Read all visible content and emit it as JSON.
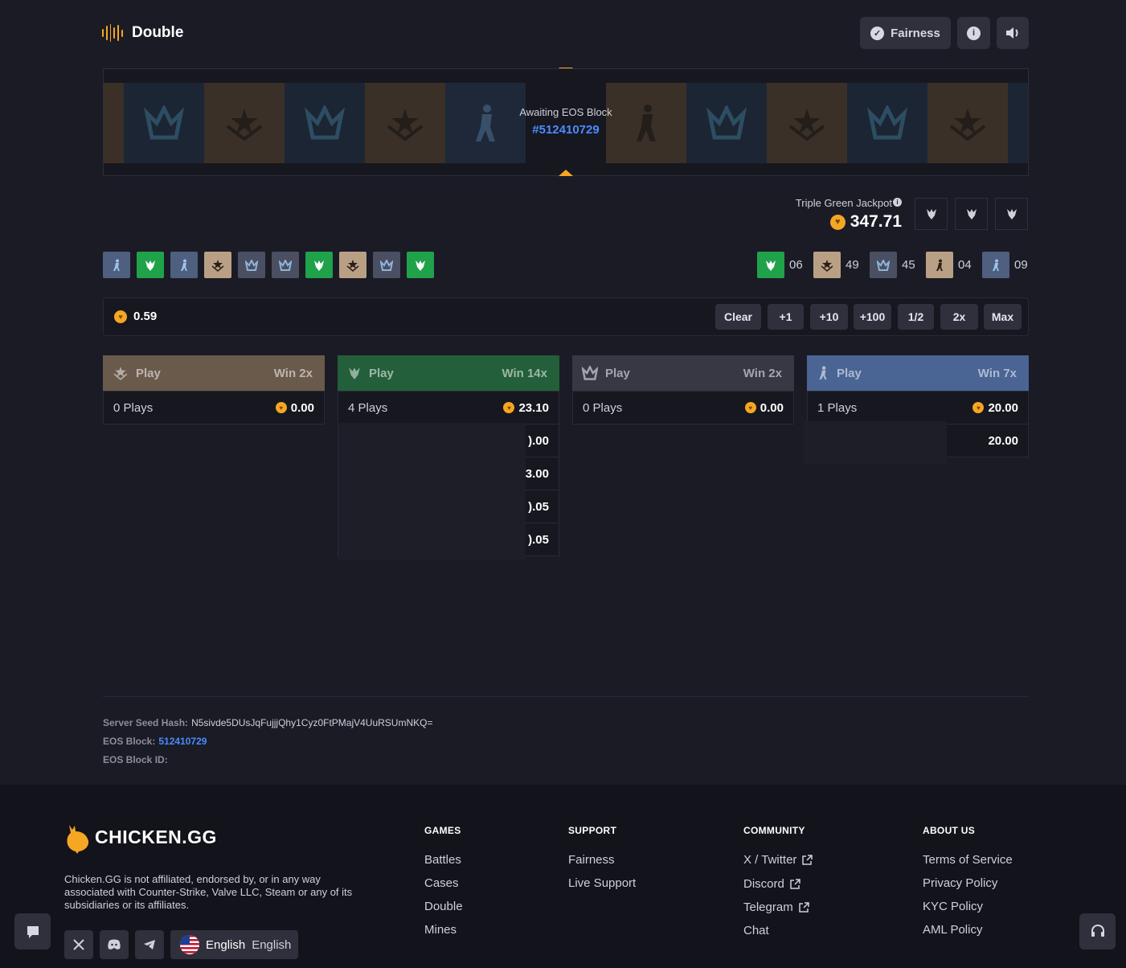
{
  "header": {
    "title": "Double",
    "fairness_label": "Fairness",
    "info_icon": "info-icon",
    "sound_icon": "speaker-icon"
  },
  "roulette": {
    "status_text": "Awaiting EOS Block",
    "block_number": "#512410729",
    "tiles": [
      "tan-badge",
      "navy-crown",
      "tan-badge",
      "navy-crown",
      "blue-soldier",
      "tan-soldier",
      "navy-crown",
      "tan-badge",
      "navy-crown",
      "tan-badge"
    ]
  },
  "jackpot": {
    "label": "Triple Green Jackpot",
    "value": "347.71",
    "slots": [
      "chicken-icon",
      "chicken-icon",
      "chicken-icon"
    ]
  },
  "history": [
    "blue-soldier",
    "green-chicken",
    "blue-soldier",
    "tan-badge",
    "gray-crown",
    "gray-crown",
    "green-chicken",
    "tan-badge",
    "gray-crown",
    "green-chicken"
  ],
  "stats": [
    {
      "type": "green-chicken",
      "count": "06"
    },
    {
      "type": "tan-badge",
      "count": "49"
    },
    {
      "type": "gray-crown",
      "count": "45"
    },
    {
      "type": "tan-soldier",
      "count": "04"
    },
    {
      "type": "blue-soldier",
      "count": "09"
    }
  ],
  "bet": {
    "amount": "0.59",
    "buttons": [
      "Clear",
      "+1",
      "+10",
      "+100",
      "1/2",
      "2x",
      "Max"
    ]
  },
  "columns": [
    {
      "play": "Play",
      "win": "Win 2x",
      "plays": "0 Plays",
      "total": "0.00",
      "color": "#6a5a4c",
      "rows": []
    },
    {
      "play": "Play",
      "win": "Win 14x",
      "plays": "4 Plays",
      "total": "23.10",
      "color": "#235f3a",
      "rows": [
        ").00",
        "3.00",
        ").05",
        ").05"
      ]
    },
    {
      "play": "Play",
      "win": "Win 2x",
      "plays": "0 Plays",
      "total": "0.00",
      "color": "#373844",
      "rows": []
    },
    {
      "play": "Play",
      "win": "Win 7x",
      "plays": "1 Plays",
      "total": "20.00",
      "color": "#4a6494",
      "rows": [
        "20.00"
      ]
    }
  ],
  "seed": {
    "hash_label": "Server Seed Hash:",
    "hash_value": "N5sivde5DUsJqFujjjQhy1Cyz0FtPMajV4UuRSUmNKQ=",
    "block_label": "EOS Block:",
    "block_value": "512410729",
    "block_id_label": "EOS Block ID:"
  },
  "footer": {
    "brand": "CHICKEN.GG",
    "disclaimer": "Chicken.GG is not affiliated, endorsed by, or in any way associated with Counter-Strike, Valve LLC, Steam or any of its subsidiaries or its affiliates.",
    "games": {
      "title": "GAMES",
      "links": [
        "Battles",
        "Cases",
        "Double",
        "Mines"
      ]
    },
    "support": {
      "title": "SUPPORT",
      "links": [
        "Fairness",
        "Live Support"
      ]
    },
    "community": {
      "title": "COMMUNITY",
      "links": [
        "X / Twitter",
        "Discord",
        "Telegram",
        "Chat"
      ]
    },
    "about": {
      "title": "ABOUT US",
      "links": [
        "Terms of Service",
        "Privacy Policy",
        "KYC Policy",
        "AML Policy"
      ]
    },
    "language": "English",
    "language_native": "English"
  },
  "colors": {
    "accent": "#f5a623",
    "link_blue": "#4a8cff",
    "green": "#1fa24a",
    "tan": "#b9a085",
    "blue": "#4e5f80"
  }
}
